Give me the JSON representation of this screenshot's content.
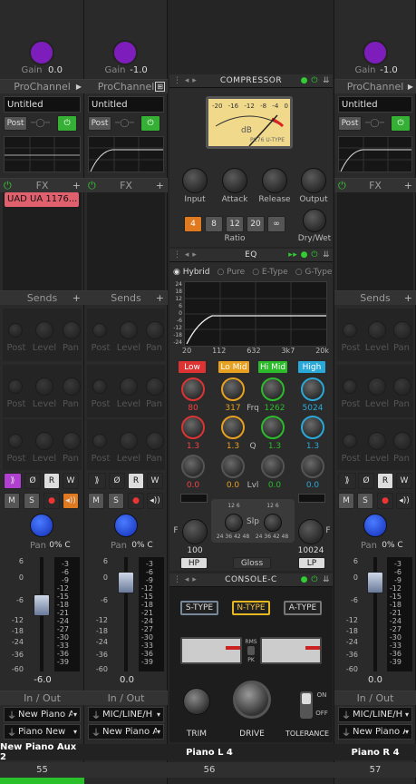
{
  "strips": [
    {
      "gain_label": "Gain",
      "gain_value": "0.0",
      "prochannel": "ProChannel",
      "preset": "Untitled",
      "post": "Post",
      "fx": "FX",
      "plugin": "UAD UA 1176...",
      "sends": "Sends",
      "send_labels": [
        "Post",
        "Level",
        "Pan"
      ],
      "pan_label": "Pan",
      "pan_value": "0% C",
      "fader_value": "-6.0",
      "fader_level": 0.62,
      "inout": "In / Out",
      "input": "New Piano Aux",
      "output": "Piano New",
      "name": "New Piano Aux 2",
      "number": "55"
    },
    {
      "gain_label": "Gain",
      "gain_value": "-1.0",
      "prochannel": "ProChannel",
      "preset": "Untitled",
      "post": "Post",
      "fx": "FX",
      "sends": "Sends",
      "send_labels": [
        "Post",
        "Level",
        "Pan"
      ],
      "pan_label": "Pan",
      "pan_value": "0% C",
      "fader_value": "0.0",
      "fader_level": 0.8,
      "inout": "In / Out",
      "input": "MIC/LINE/H",
      "output": "New Piano A",
      "name": "Piano L 4",
      "number": "56"
    },
    {
      "gain_label": "Gain",
      "gain_value": "-1.0",
      "prochannel": "ProChannel",
      "preset": "Untitled",
      "post": "Post",
      "fx": "FX",
      "sends": "Sends",
      "send_labels": [
        "Post",
        "Level",
        "Pan"
      ],
      "pan_label": "Pan",
      "pan_value": "0% C",
      "fader_value": "0.0",
      "fader_level": 0.8,
      "inout": "In / Out",
      "input": "MIC/LINE/H",
      "output": "New Piano A",
      "name": "Piano R 4",
      "number": "57"
    }
  ],
  "fader_scale": [
    "6",
    "0",
    "-6",
    "-12",
    "-18",
    "-24",
    "-36",
    "-60"
  ],
  "meter_scale": [
    "-3",
    "-6",
    "-9",
    "-12",
    "-15",
    "-18",
    "-21",
    "-24",
    "-27",
    "-30",
    "-33",
    "-36",
    "-39"
  ],
  "buttons": {
    "mute": "M",
    "solo": "S",
    "read": "R",
    "write": "W",
    "phase": "Ø"
  },
  "compressor": {
    "title": "COMPRESSOR",
    "meter_ticks": [
      "-20",
      "-16",
      "-12",
      "-8",
      "-4",
      "0",
      "-3",
      "-4"
    ],
    "meter_unit": "dB",
    "model": "PC76 U-TYPE",
    "knobs": [
      "Input",
      "Attack",
      "Release",
      "Output"
    ],
    "ratios": [
      "4",
      "8",
      "12",
      "20",
      "∞"
    ],
    "ratio_label": "Ratio",
    "drywet": "Dry/Wet"
  },
  "eq": {
    "title": "EQ",
    "modes": [
      "Hybrid",
      "Pure",
      "E-Type",
      "G-Type"
    ],
    "y_ticks": [
      "24",
      "18",
      "12",
      "6",
      "0",
      "-6",
      "-12",
      "-18",
      "-24"
    ],
    "x_ticks": [
      "20",
      "112",
      "632",
      "3k7",
      "20k"
    ],
    "bands": [
      "Low",
      "Lo Mid",
      "Hi Mid",
      "High"
    ],
    "band_colors": [
      "#d33",
      "#e8a020",
      "#2bbb2b",
      "#2aa8d8"
    ],
    "freqs": [
      "80",
      "317",
      "1262",
      "5024"
    ],
    "freq_label": "Frq",
    "qs": [
      "1.3",
      "1.3",
      "1.3",
      "1.3"
    ],
    "q_label": "Q",
    "levels": [
      "0.0",
      "0.0",
      "0.0",
      "0.0"
    ],
    "lvl_label": "Lvl",
    "hp_freq": "100",
    "hp": "HP",
    "lp_freq": "10024",
    "lp": "LP",
    "slope_label": "Slp",
    "slope_ticks": [
      "12",
      "6",
      "24",
      "36",
      "42",
      "48",
      "12",
      "6",
      "24",
      "36",
      "42",
      "48"
    ],
    "gloss": "Gloss",
    "f_label": "F"
  },
  "console": {
    "title": "CONSOLE-C",
    "types": [
      "S-TYPE",
      "N-TYPE",
      "A-TYPE"
    ],
    "rms": "RMS",
    "pk": "PK",
    "trim": "TRIM",
    "drive": "DRIVE",
    "tolerance": "TOLERANCE",
    "on": "ON",
    "off": "OFF"
  }
}
